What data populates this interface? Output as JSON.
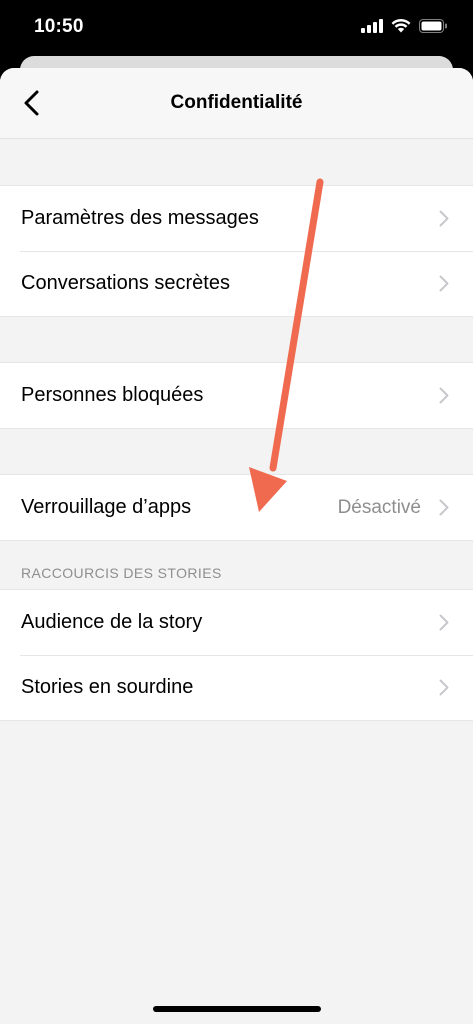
{
  "status_bar": {
    "time": "10:50"
  },
  "nav": {
    "title": "Confidentialité"
  },
  "groups": [
    {
      "items": [
        {
          "label": "Paramètres des messages"
        },
        {
          "label": "Conversations secrètes"
        }
      ]
    },
    {
      "items": [
        {
          "label": "Personnes bloquées"
        }
      ]
    },
    {
      "items": [
        {
          "label": "Verrouillage d’apps",
          "value": "Désactivé"
        }
      ]
    }
  ],
  "stories_section": {
    "header": "RACCOURCIS DES STORIES",
    "items": [
      {
        "label": "Audience de la story"
      },
      {
        "label": "Stories en sourdine"
      }
    ]
  },
  "colors": {
    "annotation_arrow": "#f06a50",
    "chevron": "#c7c7cc",
    "secondary_text": "#8e8e8e"
  }
}
